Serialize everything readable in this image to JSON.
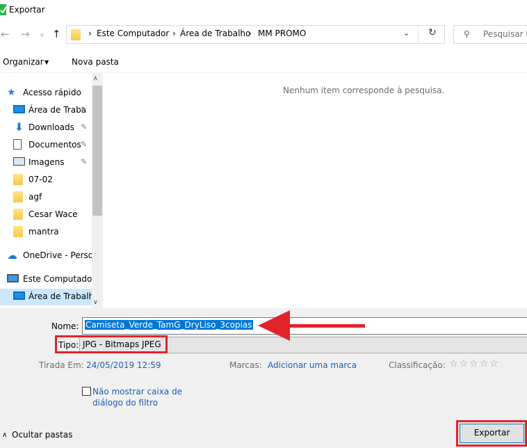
{
  "window": {
    "title": "Exportar",
    "accent": "#0078d7"
  },
  "address": {
    "crumbs": [
      "Este Computador",
      "Área de Trabalho",
      "MM PROMO"
    ],
    "separator": "›",
    "search_placeholder": "Pesquisar M"
  },
  "toolbar": {
    "organize": "Organizar",
    "new_folder": "Nova pasta"
  },
  "nav": {
    "quick_access": "Acesso rápido",
    "items": [
      {
        "label": "Área de Traba",
        "icon": "desktop-icon",
        "pinned": true
      },
      {
        "label": "Downloads",
        "icon": "download-icon",
        "pinned": true
      },
      {
        "label": "Documentos",
        "icon": "document-icon",
        "pinned": true
      },
      {
        "label": "Imagens",
        "icon": "pictures-icon",
        "pinned": true
      },
      {
        "label": "07-02",
        "icon": "folder-icon",
        "pinned": false
      },
      {
        "label": "agf",
        "icon": "folder-icon",
        "pinned": false
      },
      {
        "label": "Cesar Wace",
        "icon": "folder-icon",
        "pinned": false
      },
      {
        "label": "mantra",
        "icon": "folder-icon",
        "pinned": false
      }
    ],
    "onedrive": "OneDrive - Persor",
    "this_pc": "Este Computador",
    "desktop_selected": "Área de Trabalho"
  },
  "content": {
    "empty_message": "Nenhum item corresponde à pesquisa."
  },
  "form": {
    "name_label": "Nome:",
    "name_value": "Camiseta_Verde_TamG_DryLiso_3copias",
    "type_label": "Tipo:",
    "type_value": "JPG - Bitmaps JPEG",
    "date_label": "Tirada Em:",
    "date_value": "24/05/2019 12:59",
    "tags_label": "Marcas:",
    "tags_value": "Adicionar uma marca",
    "rating_label": "Classificação:",
    "rating_stars": "☆☆☆☆☆",
    "filter_label": "Não mostrar caixa de diálogo do filtro",
    "hide_folders": "Ocultar pastas",
    "export_button": "Exportar"
  },
  "annotations": {
    "highlight_color": "#e2232a"
  }
}
